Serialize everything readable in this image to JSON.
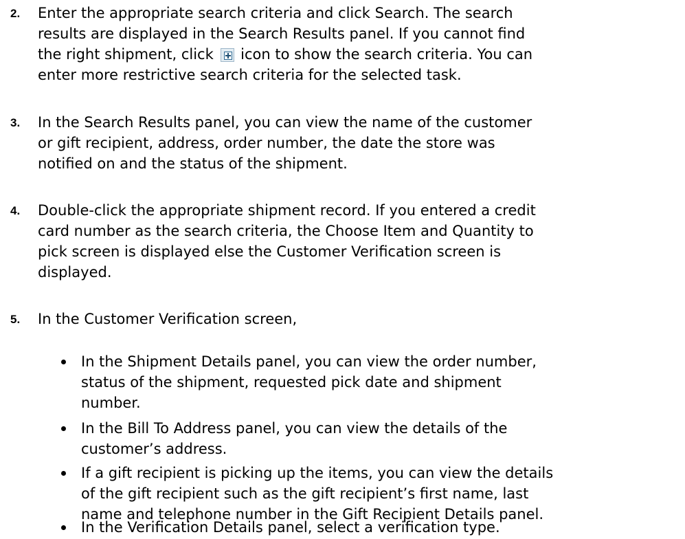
{
  "steps": [
    {
      "number": "2.",
      "line1_before_icon": "Enter the appropriate search criteria and click Search. The search",
      "line2": "results are displayed in the Search Results panel. If you cannot find",
      "line3_before_icon": "the right shipment, click",
      "icon": "expand-plus-icon",
      "line3_after_icon": "icon to show the search criteria. You can",
      "line4": "enter more restrictive search criteria for the selected task."
    },
    {
      "number": "3.",
      "lines": [
        "In the Search Results panel, you can view the name of the customer",
        "or gift recipient, address, order number, the date the store was",
        "notified on and the status of the shipment."
      ]
    },
    {
      "number": "4.",
      "lines": [
        "Double-click the appropriate shipment record. If you entered a credit",
        "card number as the search criteria, the Choose Item and Quantity to",
        "pick screen is displayed else the Customer Verification screen is",
        "displayed."
      ]
    },
    {
      "number": "5.",
      "lines": [
        "In the Customer Verification screen,"
      ]
    }
  ],
  "bullets": [
    {
      "lines": [
        "In the Shipment Details panel, you can view the order number,",
        "status of the shipment, requested pick date and shipment",
        "number."
      ]
    },
    {
      "lines": [
        "In the Bill To Address panel, you can view the details of the",
        "customer’s address."
      ]
    },
    {
      "lines": [
        "If a gift recipient is picking up the items, you can view the details",
        "of the gift recipient such as the gift recipient’s first name, last",
        "name and telephone number in the Gift Recipient Details panel."
      ]
    },
    {
      "lines": [
        "In the Verification Details panel, select a verification type."
      ]
    }
  ]
}
